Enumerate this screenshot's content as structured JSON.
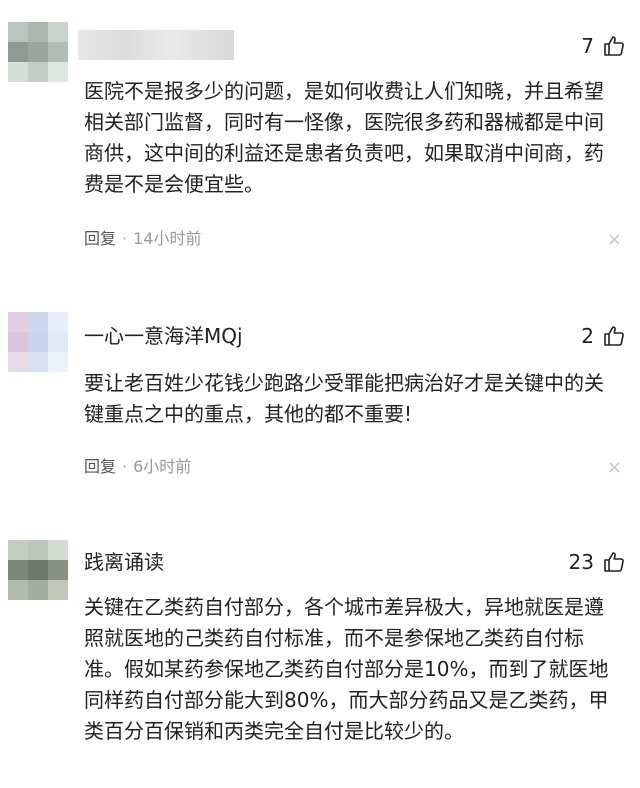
{
  "comments": [
    {
      "username": "",
      "likes": "7",
      "content": "医院不是报多少的问题，是如何收费让人们知晓，并且希望相关部门监督，同时有一怪像，医院很多药和器械都是中间商供，这中间的利益还是患者负责吧，如果取消中间商，药费是不是会便宜些。",
      "reply_label": "回复",
      "separator": "·",
      "time": "14小时前",
      "close_icon": "×"
    },
    {
      "username": "一心一意海洋MQj",
      "likes": "2",
      "content": "要让老百姓少花钱少跑路少受罪能把病治好才是关键中的关键重点之中的重点，其他的都不重要!",
      "reply_label": "回复",
      "separator": "·",
      "time": "6小时前",
      "close_icon": "×"
    },
    {
      "username": "践离诵读",
      "likes": "23",
      "content": "关键在乙类药自付部分，各个城市差异极大，异地就医是遵照就医地的己类药自付标准，而不是参保地乙类药自付标准。假如某药参保地乙类药自付部分是10%，而到了就医地同样药自付部分能大到80%，而大部分药品又是乙类药，甲类百分百保销和丙类完全自付是比较少的。"
    }
  ],
  "icons": {
    "like": "thumbs-up-icon",
    "avatar": "avatar",
    "close": "close-icon"
  }
}
